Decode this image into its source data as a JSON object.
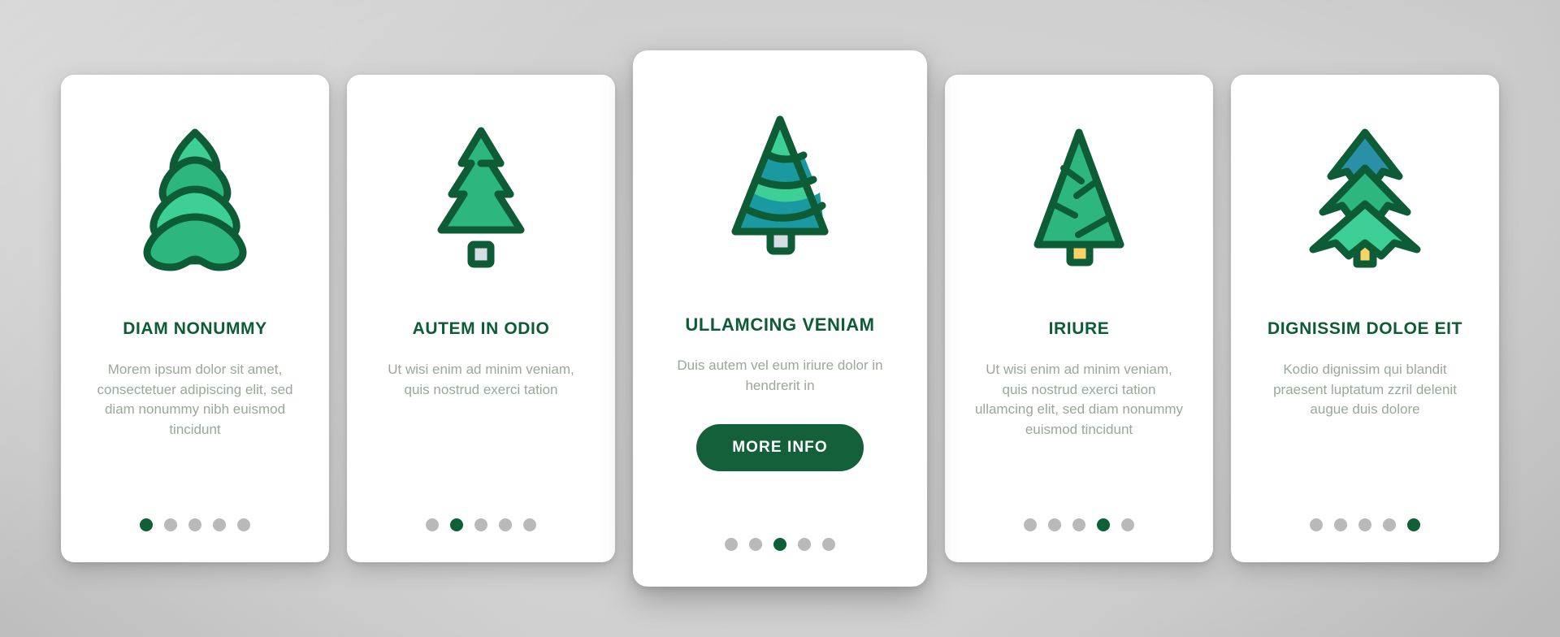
{
  "theme": {
    "background_base": "#cfcfcf",
    "card_background": "#ffffff",
    "title_color": "#0d5c36",
    "body_text_color": "#9ba79b",
    "accent_green": "#14603a",
    "dot_inactive": "#b9b9b9",
    "dot_active": "#0f6034",
    "icon_outline": "#0d5c36",
    "icon_green_light": "#3ecf96",
    "icon_green_mid": "#2db77f",
    "icon_green_dark": "#25a877",
    "icon_teal": "#1a9aa0",
    "icon_blue_teal": "#2a8fa8",
    "icon_trunk_yellow": "#fbd266",
    "icon_trunk_gray": "#d6dce4"
  },
  "carousel": {
    "dot_count": 5,
    "cards": [
      {
        "id": "card-1",
        "icon_name": "layered-fir-tree-icon",
        "title": "DIAM NONUMMY",
        "body": "Morem ipsum dolor sit amet, consectetuer adipiscing elit, sed diam nonummy nibh euismod tincidunt",
        "active_dot": 1,
        "featured": false,
        "cta_label": null
      },
      {
        "id": "card-2",
        "icon_name": "pointed-pine-tree-icon",
        "title": "AUTEM IN ODIO",
        "body": "Ut wisi enim ad minim veniam, quis nostrud exerci tation",
        "active_dot": 2,
        "featured": false,
        "cta_label": null
      },
      {
        "id": "card-3",
        "icon_name": "banded-cone-tree-icon",
        "title": "ULLAMCING VENIAM",
        "body": "Duis autem vel eum iriure dolor in hendrerit in",
        "active_dot": 3,
        "featured": true,
        "cta_label": "MORE INFO"
      },
      {
        "id": "card-4",
        "icon_name": "triangle-branch-tree-icon",
        "title": "IRIURE",
        "body": "Ut wisi enim ad minim veniam, quis nostrud exerci tation ullamcing elit, sed diam nonummy euismod tincidunt",
        "active_dot": 4,
        "featured": false,
        "cta_label": null
      },
      {
        "id": "card-5",
        "icon_name": "zigzag-spruce-tree-icon",
        "title": "DIGNISSIM DOLOE EIT",
        "body": "Kodio dignissim qui blandit praesent luptatum zzril delenit augue duis dolore",
        "active_dot": 5,
        "featured": false,
        "cta_label": null
      }
    ]
  }
}
